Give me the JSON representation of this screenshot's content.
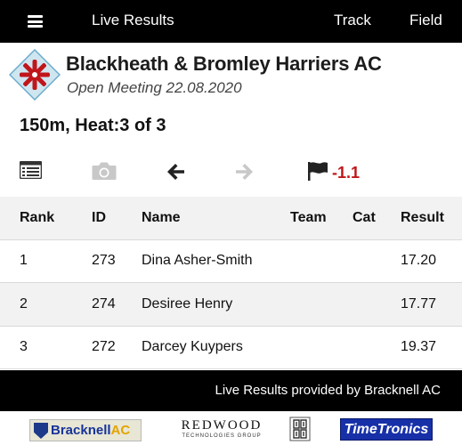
{
  "nav": {
    "title": "Live Results",
    "track": "Track",
    "field": "Field"
  },
  "club": {
    "name": "Blackheath & Bromley Harriers AC",
    "meeting": "Open Meeting 22.08.2020"
  },
  "event": {
    "title": "150m, Heat:3 of 3"
  },
  "toolbar": {
    "icons": [
      "list-icon",
      "camera-icon",
      "back-arrow-icon",
      "forward-arrow-icon",
      "flag-icon"
    ],
    "wind": "-1.1"
  },
  "results": {
    "headers": [
      "Rank",
      "ID",
      "Name",
      "Team",
      "Cat",
      "Result"
    ],
    "rows": [
      {
        "rank": "1",
        "id": "273",
        "name": "Dina Asher-Smith",
        "team": "",
        "cat": "",
        "result": "17.20"
      },
      {
        "rank": "2",
        "id": "274",
        "name": "Desiree Henry",
        "team": "",
        "cat": "",
        "result": "17.77"
      },
      {
        "rank": "3",
        "id": "272",
        "name": "Darcey Kuypers",
        "team": "",
        "cat": "",
        "result": "19.37"
      }
    ]
  },
  "footer": {
    "text": "Live Results provided by Bracknell AC"
  },
  "sponsors": {
    "bracknell": "Bracknell",
    "bracknell_ac": "AC",
    "redwood": "REDWOOD",
    "redwood_sub": "TECHNOLOGIES GROUP",
    "timetronics": "TimeTronics"
  },
  "colors": {
    "topbar": "#000000",
    "wind": "#c0161b",
    "row_alt": "#f2f2f2",
    "logo_blue": "#1d3a8a",
    "logo_red": "#c0161b"
  }
}
